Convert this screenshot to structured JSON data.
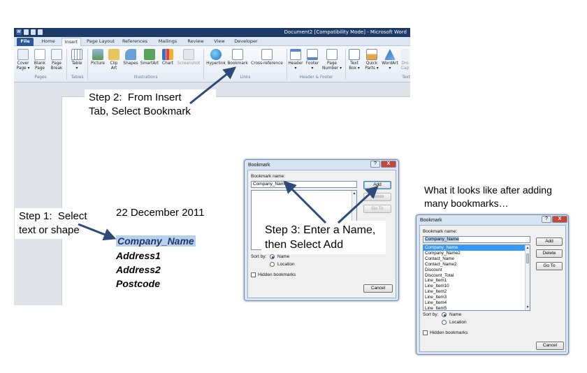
{
  "word": {
    "title": "Document2 [Compatibility Mode] - Microsoft Word",
    "tabs": [
      "File",
      "Home",
      "Insert",
      "Page Layout",
      "References",
      "Mailings",
      "Review",
      "View",
      "Developer"
    ],
    "active_tab": "Insert",
    "ribbon": {
      "cover_page": "Cover\nPage ▾",
      "blank_page": "Blank\nPage",
      "page_break": "Page\nBreak",
      "table": "Table\n▾",
      "picture": "Picture",
      "clip_art": "Clip\nArt",
      "shapes": "Shapes",
      "smartart": "SmartArt",
      "chart": "Chart",
      "screenshot": "Screenshot",
      "hyperlink": "Hyperlink",
      "bookmark": "Bookmark",
      "cross_reference": "Cross-reference",
      "header": "Header\n▾",
      "footer": "Footer\n▾",
      "page_number": "Page\nNumber ▾",
      "text_box": "Text\nBox ▾",
      "quick_parts": "Quick\nParts ▾",
      "wordart": "WordArt\n▾",
      "drop_cap": "Dro\nCap",
      "groups": {
        "pages": "Pages",
        "tables": "Tables",
        "illustrations": "Illustrations",
        "links": "Links",
        "header_footer": "Header & Footer",
        "text": "Text"
      }
    },
    "document": {
      "date": "22 December 2011",
      "lines": [
        "Company_Name",
        "Address1",
        "Address2",
        "Postcode"
      ]
    }
  },
  "callouts": {
    "step1": "Step 1:  Select\ntext or shape",
    "step2": "Step 2:  From Insert\nTab, Select Bookmark",
    "step3": "Step 3: Enter a Name,\nthen Select Add",
    "after": "What it looks like after adding\nmany bookmarks…"
  },
  "dialog1": {
    "title": "Bookmark",
    "help": "?",
    "close": "X",
    "name_label": "Bookmark name:",
    "name_value": "Company_Name",
    "add": "Add",
    "delete": "Delete",
    "goto": "Go To",
    "sort_by": "Sort by:",
    "opt_name": "Name",
    "opt_location": "Location",
    "hidden": "Hidden bookmarks",
    "cancel": "Cancel"
  },
  "dialog2": {
    "title": "Bookmark",
    "help": "?",
    "close": "X",
    "name_label": "Bookmark name:",
    "name_value": "Company_Name",
    "items": [
      "Company_Name",
      "Company_Name2",
      "Contact_Name",
      "Contact_Name2",
      "Discount",
      "Discount_Total",
      "Line_Item1",
      "Line_Item10",
      "Line_Item2",
      "Line_Item3",
      "Line_Item4",
      "Line_Item5"
    ],
    "add": "Add",
    "delete": "Delete",
    "goto": "Go To",
    "sort_by": "Sort by:",
    "opt_name": "Name",
    "opt_location": "Location",
    "hidden": "Hidden bookmarks",
    "cancel": "Cancel"
  },
  "colors": {
    "arrow": "#2e4a78",
    "titlebar": "#1d3a66",
    "selection": "#b7d0ee",
    "list_selected": "#3399ff"
  }
}
